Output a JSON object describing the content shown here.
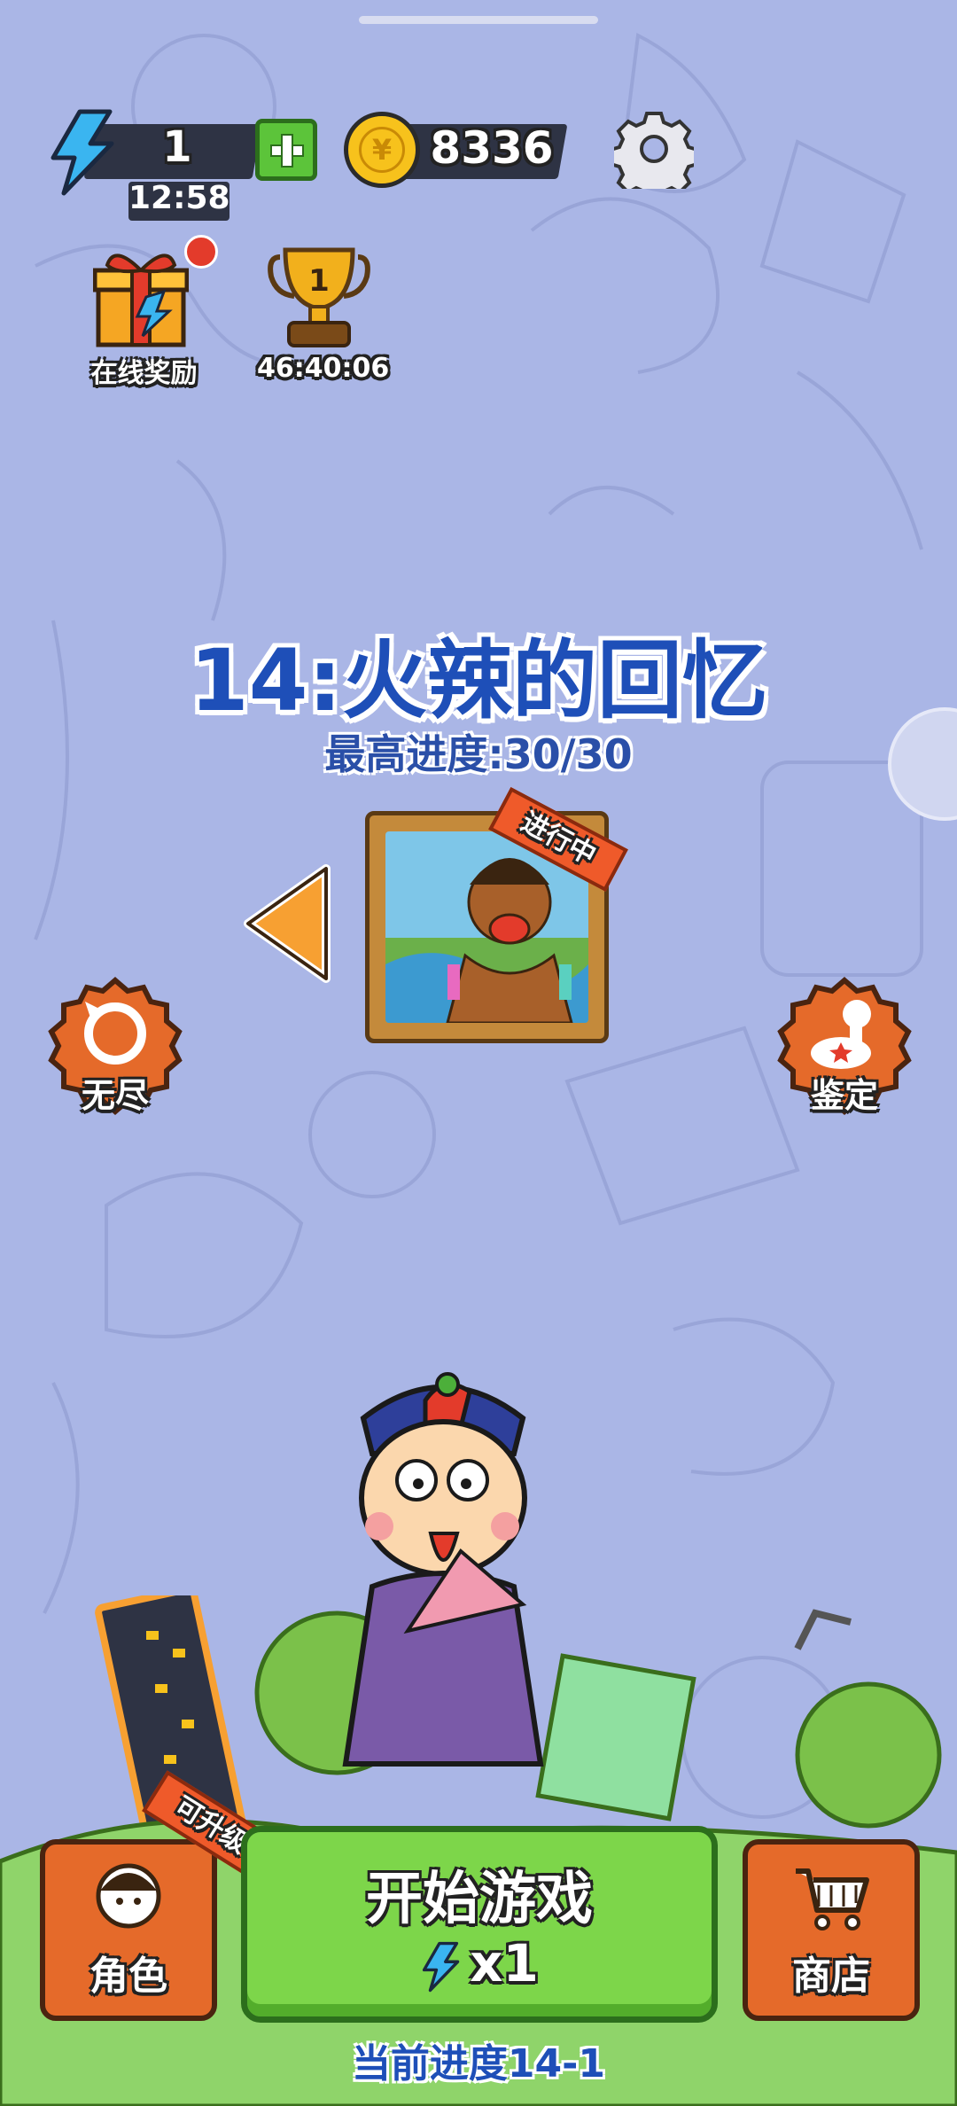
{
  "header": {
    "energy_value": "1",
    "energy_timer": "12:58",
    "coins": "8336"
  },
  "rewards": {
    "online_reward_label": "在线奖励",
    "ranking_rank": "1",
    "ranking_timer": "46:40:06"
  },
  "level": {
    "title": "14:火辣的回忆",
    "best_progress": "最高进度:30/30",
    "status_ribbon": "进行中"
  },
  "modes": {
    "endless_label": "无尽",
    "appraise_label": "鉴定"
  },
  "bottom": {
    "role_label": "角色",
    "upgrade_tag": "可升级",
    "start_label": "开始游戏",
    "start_cost": "x1",
    "shop_label": "商店",
    "current_progress": "当前进度14-1"
  },
  "colors": {
    "background": "#aab6e6",
    "title_blue": "#1e4fb8",
    "button_orange": "#e56a2a",
    "button_green": "#7dd64a"
  },
  "icons": [
    "energy-bolt-icon",
    "plus-icon",
    "coin-icon",
    "gear-icon",
    "gift-icon",
    "trophy-icon",
    "left-arrow-icon",
    "endless-icon",
    "appraise-icon",
    "character-icon",
    "cart-icon"
  ]
}
